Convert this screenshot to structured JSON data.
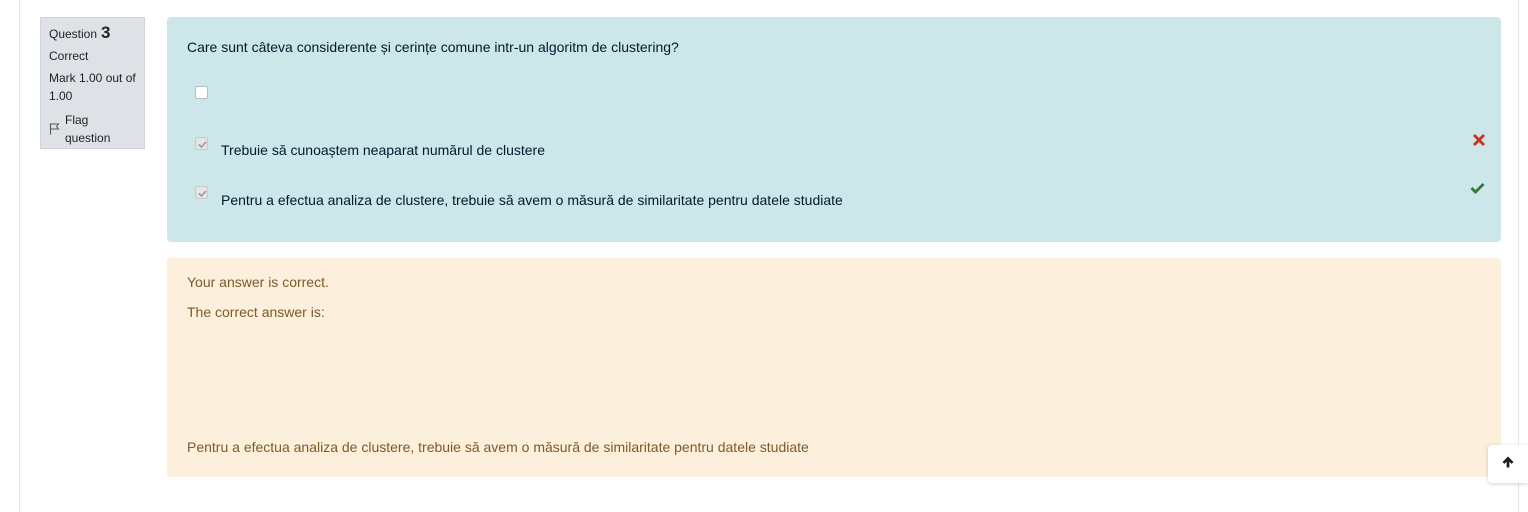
{
  "question_info": {
    "question_word": "Question",
    "question_number": "3",
    "state": "Correct",
    "mark": "Mark 1.00 out of 1.00",
    "flag_label": "Flag question"
  },
  "question": {
    "text": "Care sunt câteva considerente și cerințe comune intr-un algoritm de clustering?",
    "options": [
      {
        "label": "",
        "checked": false,
        "mark": "none"
      },
      {
        "label": "Trebuie să cunoaștem neaparat numărul de clustere",
        "checked": true,
        "mark": "incorrect-icon"
      },
      {
        "label": "Pentru a efectua analiza de clustere, trebuie să avem o măsură de similaritate pentru datele studiate",
        "checked": true,
        "mark": "correct-icon"
      }
    ]
  },
  "feedback": {
    "status": "Your answer is correct.",
    "right_answer_heading": "The correct answer is:",
    "right_answer": "Pentru a efectua analiza de clustere, trebuie să avem o măsură de similaritate pentru datele studiate"
  },
  "colors": {
    "formulation_bg": "#cde6ea",
    "feedback_bg": "#fcefdc",
    "info_bg": "#dee2e6",
    "incorrect": "#ca3120",
    "correct": "#357a32"
  },
  "icons": {
    "flag": "flag-icon",
    "back_to_top": "arrow-up-icon"
  }
}
